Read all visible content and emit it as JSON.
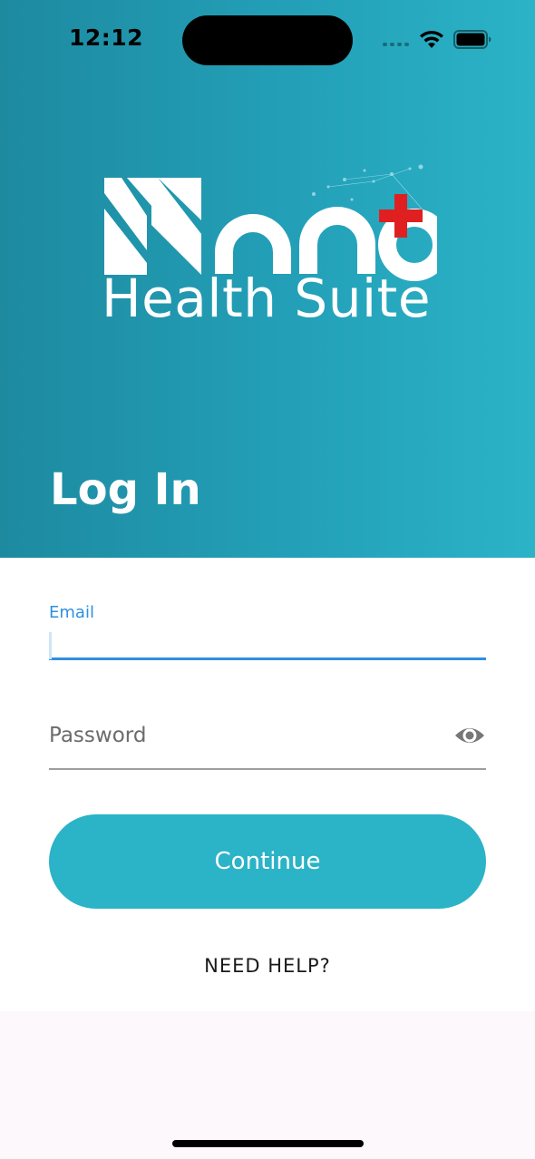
{
  "status_bar": {
    "time": "12:12",
    "icons": [
      "cellular-signal-icon",
      "wifi-icon",
      "battery-icon"
    ]
  },
  "logo": {
    "wordmark": "Nano",
    "tagline": "Health Suite",
    "cross_color": "#e02020"
  },
  "page": {
    "title": "Log In"
  },
  "form": {
    "email_label": "Email",
    "email_value": "",
    "password_placeholder": "Password",
    "password_value": "",
    "visibility_icon": "eye-icon",
    "continue_label": "Continue",
    "help_label": "NEED HELP?"
  },
  "colors": {
    "accent": "#2bb3c7",
    "focus_underline": "#2f8fe0",
    "header_gradient_start": "#1d8aa0",
    "header_gradient_end": "#2bb3c7",
    "page_background": "#fdf8fc"
  }
}
